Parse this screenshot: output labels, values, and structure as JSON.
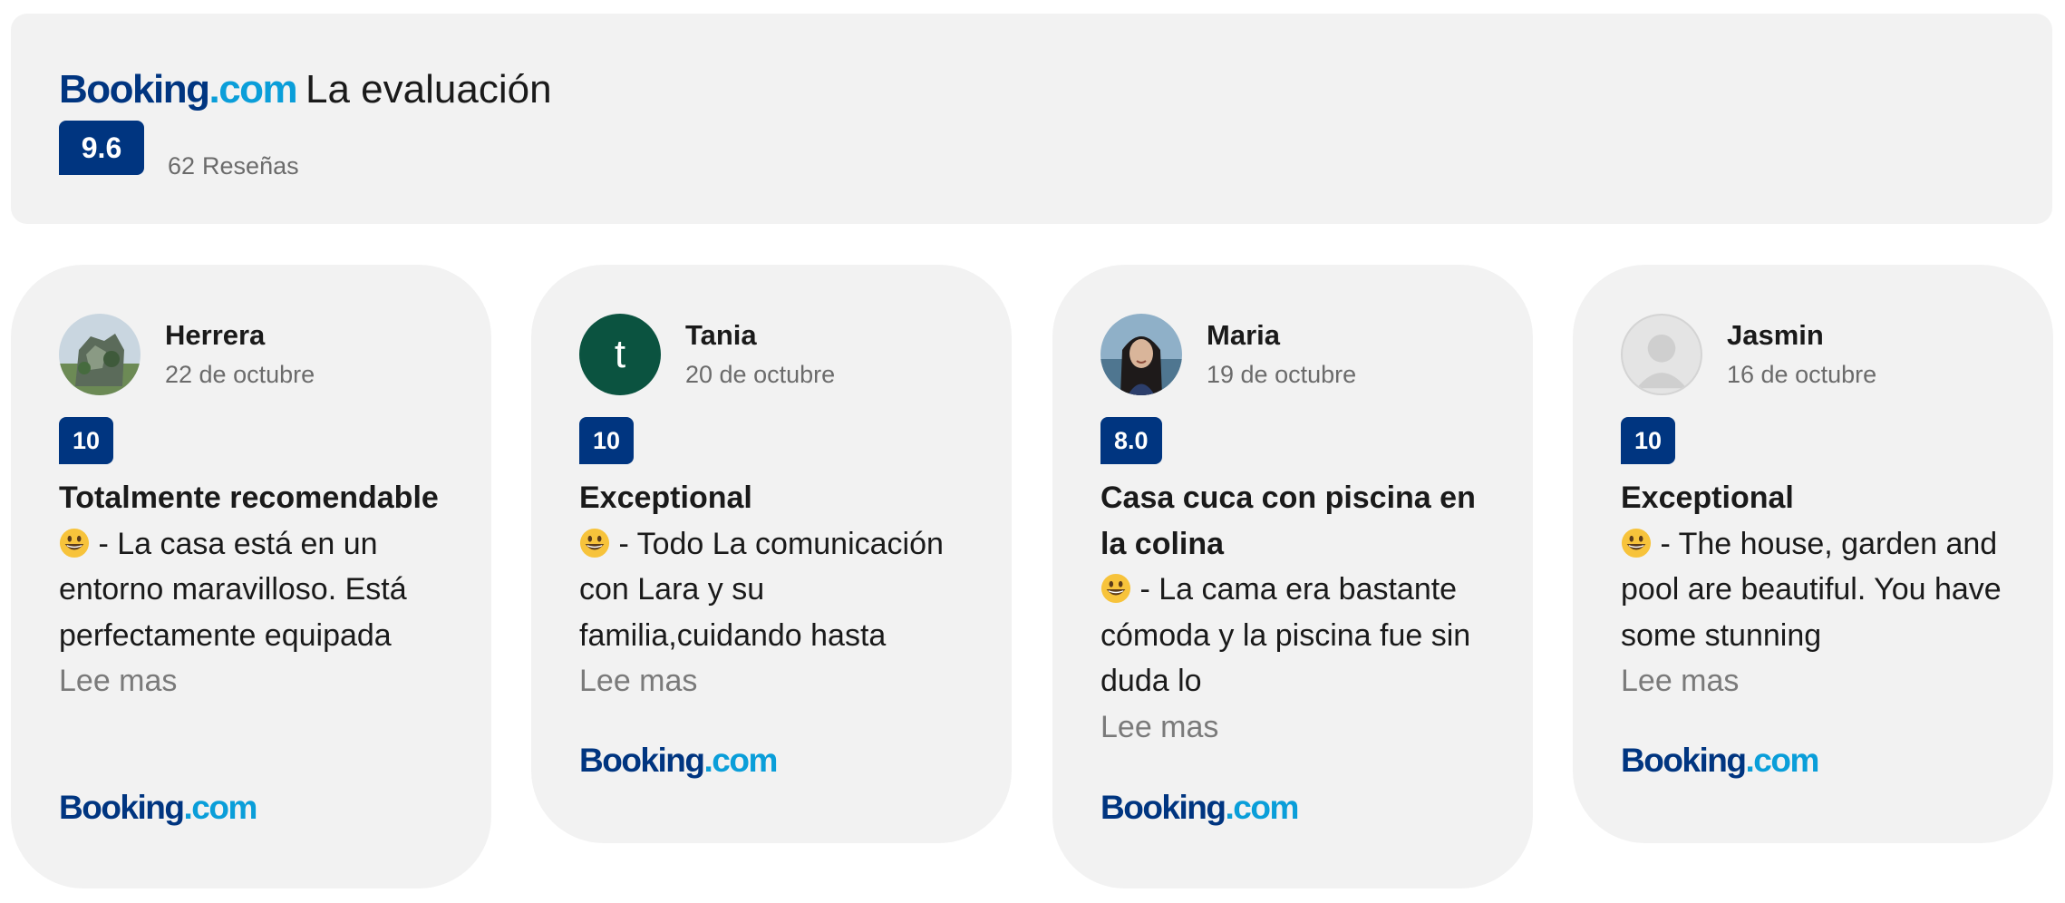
{
  "brand": {
    "part1": "Booking",
    "part2": ".com"
  },
  "header": {
    "title": "La evaluación",
    "score": "9.6",
    "review_count": "62",
    "reviews_label": "Reseñas"
  },
  "reviews": [
    {
      "name": "Herrera",
      "date": "22 de octubre",
      "rating": "10",
      "title": "Totalmente recomendable",
      "text": " - La casa está en un entorno maravilloso. Está perfectamente equipada",
      "more": "Lee mas"
    },
    {
      "name": "Tania",
      "initial": "t",
      "date": "20 de octubre",
      "rating": "10",
      "title": "Exceptional",
      "text": " - Todo La comunicación con Lara y su familia,cuidando hasta",
      "more": "Lee mas"
    },
    {
      "name": "Maria",
      "date": "19 de octubre",
      "rating": "8.0",
      "title": "Casa cuca con piscina en la colina",
      "text": " - La cama era bastante cómoda y la piscina fue sin duda lo",
      "more": "Lee mas"
    },
    {
      "name": "Jasmin",
      "date": "16 de octubre",
      "rating": "10",
      "title": "Exceptional",
      "text": " - The house, garden and pool are beautiful. You have some stunning",
      "more": "Lee mas"
    }
  ],
  "colors": {
    "brand_dark": "#003580",
    "brand_light": "#0a9ed9",
    "card_bg": "#f2f2f2",
    "tania_avatar": "#0b5340"
  },
  "icons": {
    "emoji": "grinning-face-icon",
    "placeholder_avatar": "user-silhouette-icon"
  }
}
